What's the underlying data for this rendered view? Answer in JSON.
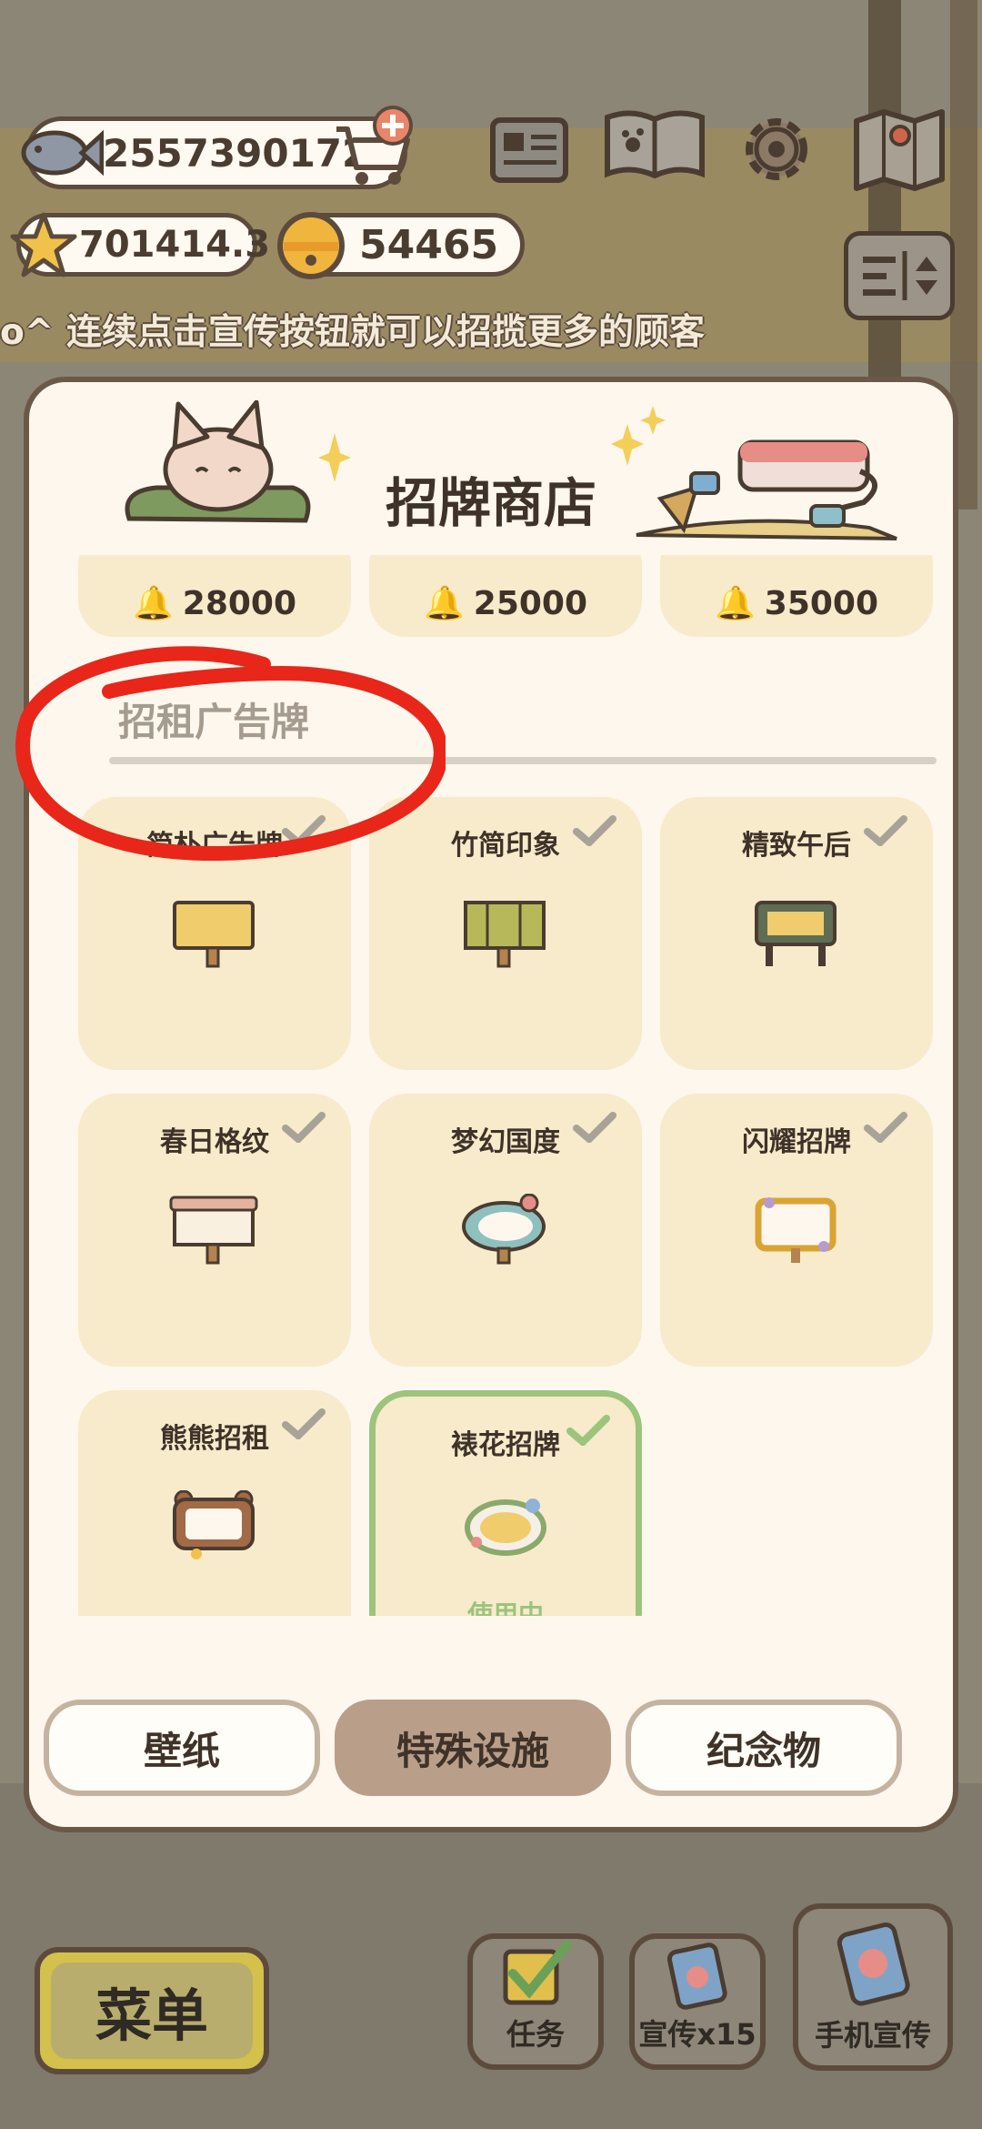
{
  "hud": {
    "fish_count": "2557390172",
    "star_count": "701414.3",
    "bell_count": "54465"
  },
  "marquee_text": "o^ 连续点击宣传按钮就可以招揽更多的顾客",
  "modal": {
    "title": "招牌商店",
    "prices": [
      "28000",
      "25000",
      "35000"
    ],
    "section_title": "招租广告牌",
    "items": [
      {
        "name": "简朴广告牌",
        "owned": true
      },
      {
        "name": "竹简印象",
        "owned": true
      },
      {
        "name": "精致午后",
        "owned": true
      },
      {
        "name": "春日格纹",
        "owned": true
      },
      {
        "name": "梦幻国度",
        "owned": true
      },
      {
        "name": "闪耀招牌",
        "owned": true
      },
      {
        "name": "熊熊招租",
        "owned": true
      },
      {
        "name": "裱花招牌",
        "owned": true,
        "in_use_label": "使用中"
      }
    ],
    "tabs": [
      "壁纸",
      "特殊设施",
      "纪念物"
    ],
    "active_tab": "特殊设施"
  },
  "bottom": {
    "menu_label": "菜单",
    "task_label": "任务",
    "promo_label": "宣传x15",
    "phone_promo_label": "手机宣传"
  },
  "colors": {
    "accent_green": "#9cc47c",
    "card_bg": "#f7ebcb",
    "annotation_red": "#e8261a"
  }
}
